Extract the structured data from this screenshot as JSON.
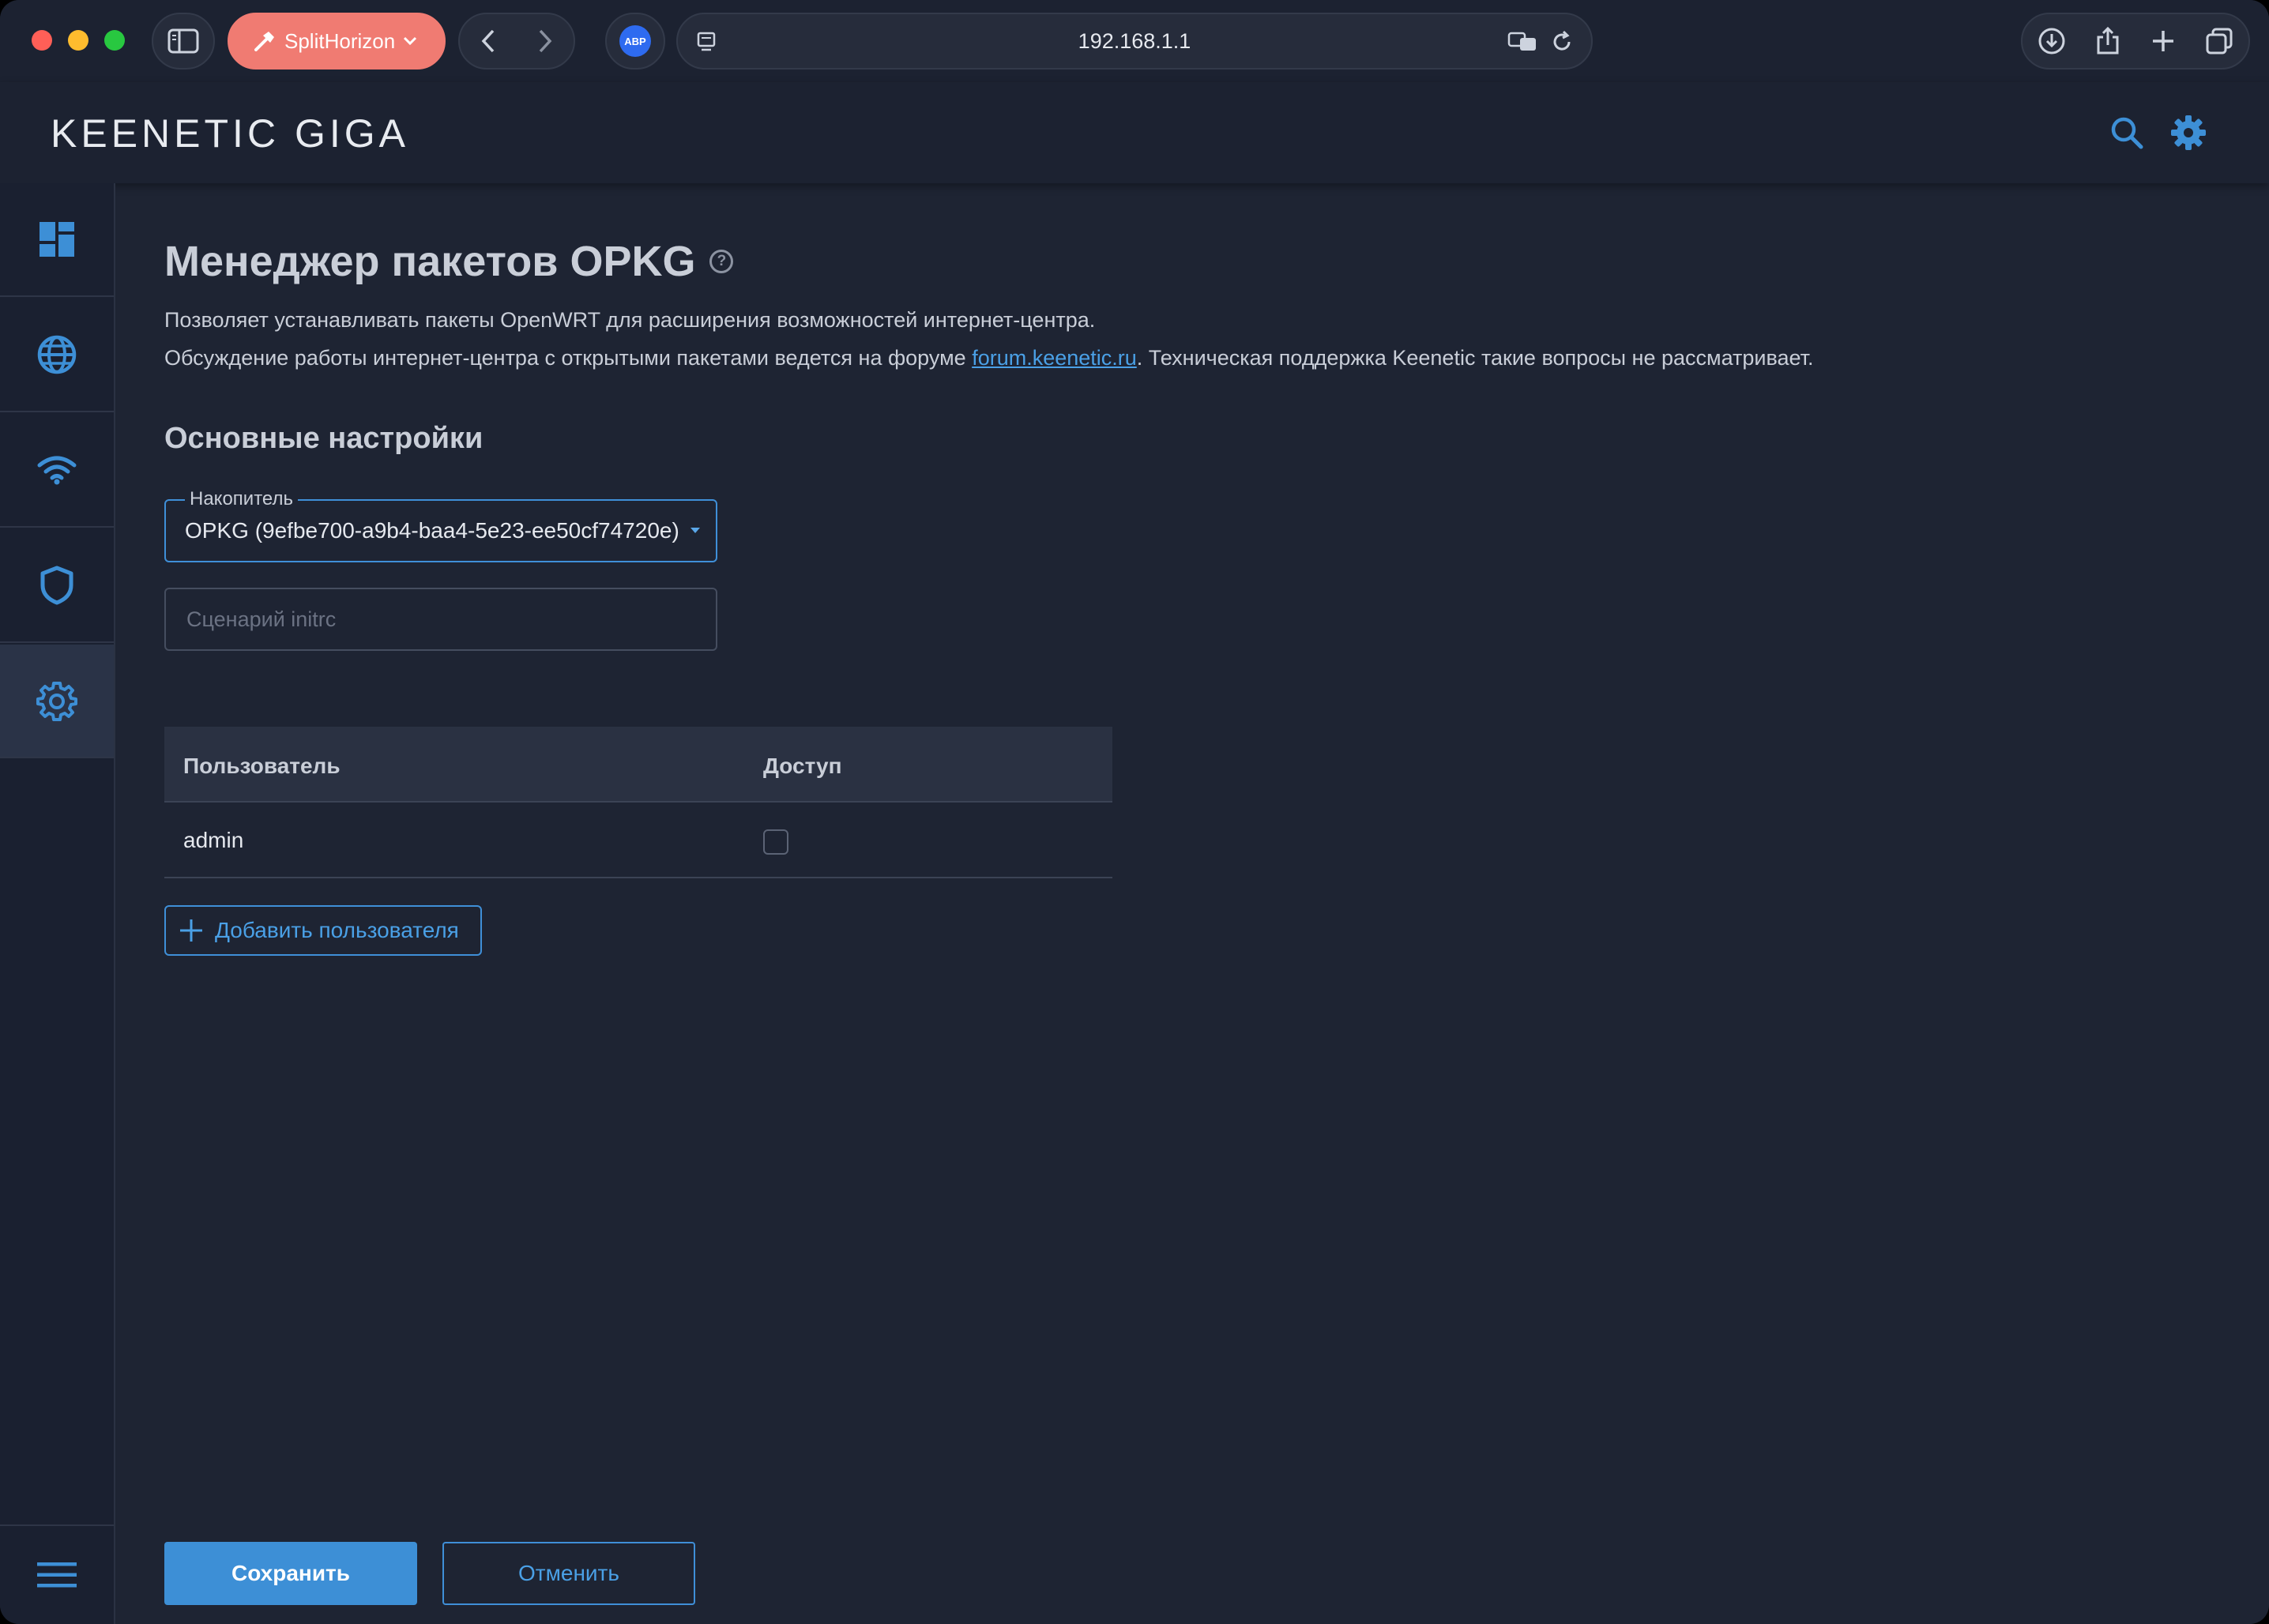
{
  "browser": {
    "tab_group_label": "SplitHorizon",
    "url": "192.168.1.1",
    "abp_label": "ABP"
  },
  "header": {
    "logo": "KEENETIC GIGA"
  },
  "page": {
    "title": "Менеджер пакетов OPKG",
    "help_glyph": "?",
    "description_line1": "Позволяет устанавливать пакеты OpenWRT для расширения возможностей интернет-центра.",
    "description_line2_before": "Обсуждение работы интернет-центра с открытыми пакетами ведется на форуме ",
    "forum_link": "forum.keenetic.ru",
    "description_line2_after": ". Техническая поддержка Keenetic такие вопросы не рассматривает."
  },
  "settings": {
    "section_title": "Основные настройки",
    "storage_label": "Накопитель",
    "storage_value": "OPKG (9efbe700-a9b4-baa4-5e23-ee50cf74720e)",
    "initrc_placeholder": "Сценарий initrc",
    "initrc_value": ""
  },
  "users_table": {
    "col_user": "Пользователь",
    "col_access": "Доступ",
    "rows": [
      {
        "user": "admin",
        "access": false
      }
    ],
    "add_button": "Добавить пользователя"
  },
  "actions": {
    "save": "Сохранить",
    "cancel": "Отменить"
  },
  "colors": {
    "accent": "#3d8fd6",
    "background": "#1e2433",
    "sidebar_active": "#2a3347"
  }
}
